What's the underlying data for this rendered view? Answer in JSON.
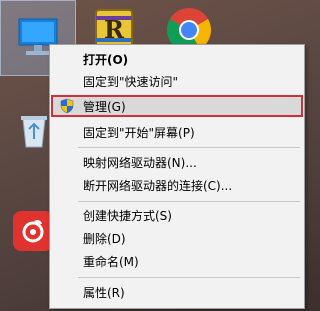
{
  "context_menu": {
    "items": [
      {
        "label": "打开(O)"
      },
      {
        "label": "固定到\"快速访问\""
      },
      {
        "label": "管理(G)"
      },
      {
        "label": "固定到\"开始\"屏幕(P)"
      },
      {
        "label": "映射网络驱动器(N)..."
      },
      {
        "label": "断开网络驱动器的连接(C)..."
      },
      {
        "label": "创建快捷方式(S)"
      },
      {
        "label": "删除(D)"
      },
      {
        "label": "重命名(M)"
      },
      {
        "label": "属性(R)"
      }
    ]
  },
  "colors": {
    "highlight_border": "#d0303a",
    "menu_background": "#f2f2f2",
    "highlight_background": "#d9d9d9"
  },
  "icons": {
    "desktop": [
      "this-pc-icon",
      "winrar-icon",
      "chrome-icon",
      "recycle-bin-icon",
      "netease-music-icon"
    ],
    "menu": [
      "uac-shield-icon"
    ]
  }
}
